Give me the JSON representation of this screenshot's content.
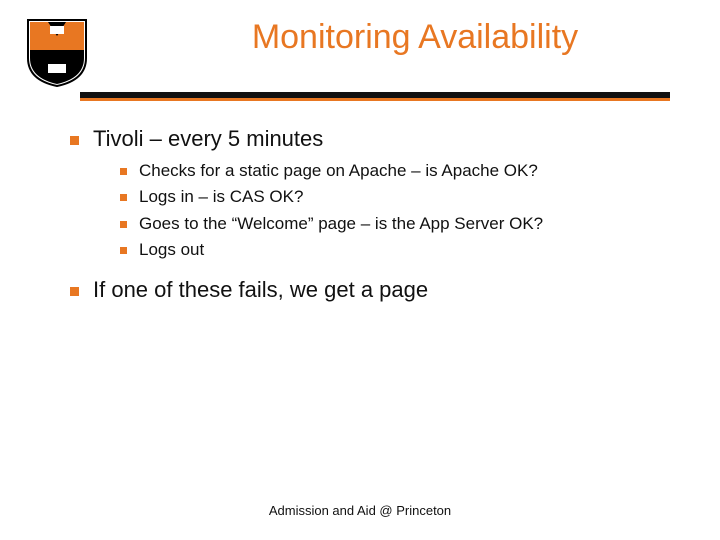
{
  "title": "Monitoring Availability",
  "bullets": {
    "b1": "Tivoli – every 5 minutes",
    "sub": {
      "s1": "Checks for a static page on Apache – is Apache OK?",
      "s2": "Logs in – is CAS OK?",
      "s3": "Goes to the “Welcome” page – is the App Server OK?",
      "s4": "Logs out"
    },
    "b2": "If one of these fails, we get a page"
  },
  "footer": "Admission and Aid @ Princeton",
  "colors": {
    "accent": "#e87722"
  }
}
